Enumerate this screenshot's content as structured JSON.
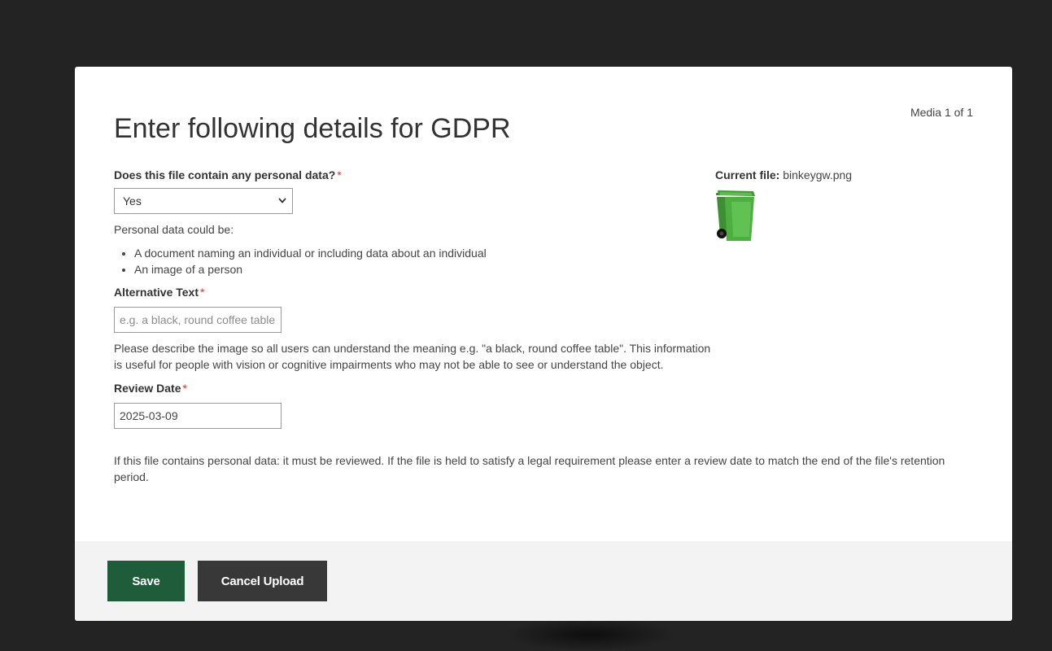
{
  "dialog": {
    "counter": "Media 1 of 1",
    "title": "Enter following details for GDPR"
  },
  "personal_data": {
    "label": "Does this file contain any personal data?",
    "required_mark": "*",
    "selected": "Yes",
    "intro": "Personal data could be:",
    "examples": [
      "A document naming an individual or including data about an individual",
      "An image of a person"
    ]
  },
  "alt_text": {
    "label": "Alternative Text",
    "required_mark": "*",
    "placeholder": "e.g. a black, round coffee table",
    "help": "Please describe the image so all users can understand the meaning e.g. \"a black, round coffee table\". This information is useful for people with vision or cognitive impairments who may not be able to see or understand the object."
  },
  "review_date": {
    "label": "Review Date",
    "required_mark": "*",
    "value": "2025-03-09",
    "help": "If this file contains personal data: it must be reviewed. If the file is held to satisfy a legal requirement please enter a review date to match the end of the file's retention period."
  },
  "current_file": {
    "label": "Current file:",
    "filename": "binkeygw.png",
    "thumbnail_icon": "green-wheelie-bin-icon"
  },
  "footer": {
    "save_label": "Save",
    "cancel_label": "Cancel Upload"
  },
  "colors": {
    "save_button": "#1e5c3a",
    "cancel_button": "#383838",
    "required": "#d9362f",
    "bin_green": "#4caf3f"
  }
}
